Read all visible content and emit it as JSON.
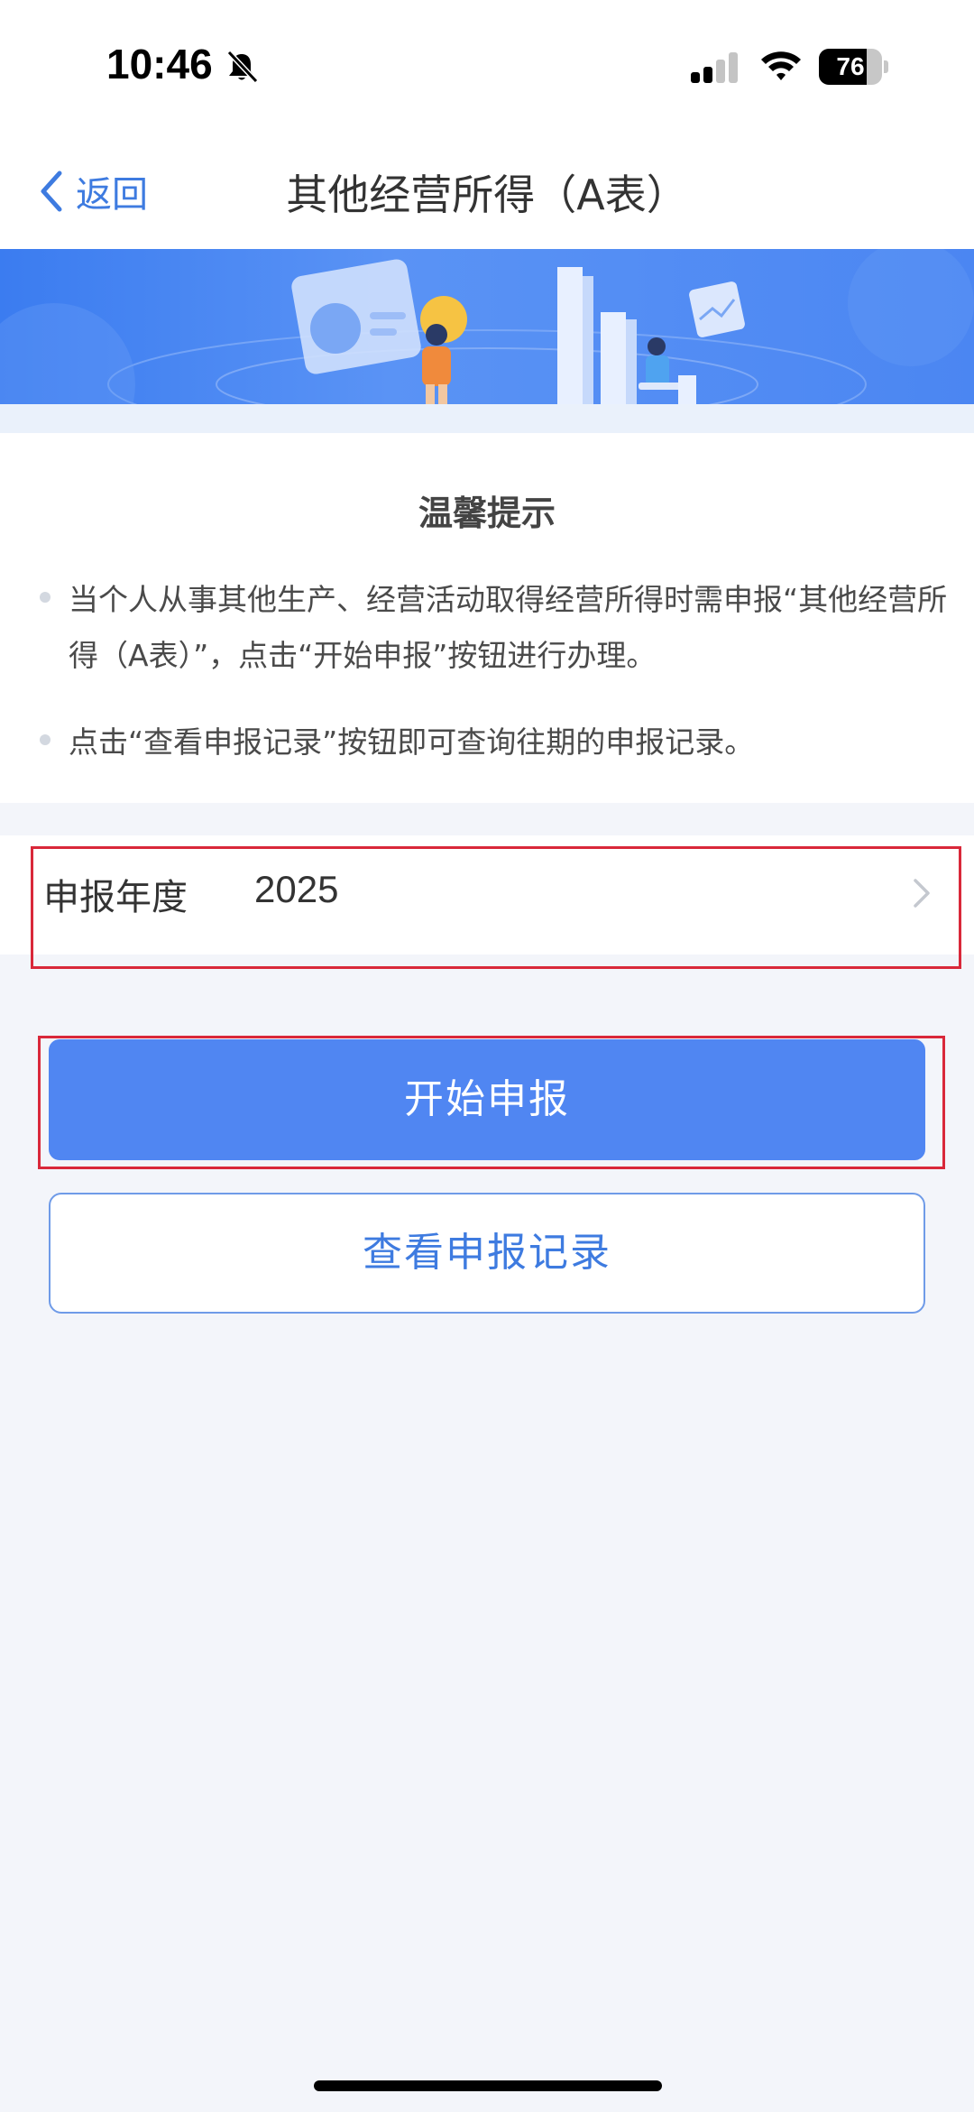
{
  "status_bar": {
    "time": "10:46",
    "battery_level": "76",
    "battery_fraction": 0.76,
    "icons": [
      "bell-slash-icon",
      "cellular-signal-icon",
      "wifi-icon",
      "battery-icon"
    ]
  },
  "nav": {
    "back_label": "返回",
    "title": "其他经营所得（A表）"
  },
  "tips": {
    "title": "温馨提示",
    "items": [
      "当个人从事其他生产、经营活动取得经营所得时需申报“其他经营所得（A表）”，点击“开始申报”按钮进行办理。",
      "点击“查看申报记录”按钮即可查询往期的申报记录。"
    ]
  },
  "year_selector": {
    "label": "申报年度",
    "value": "2025"
  },
  "actions": {
    "start_label": "开始申报",
    "records_label": "查看申报记录"
  },
  "colors": {
    "accent": "#5086f2",
    "link": "#3e7be0",
    "highlight": "#d9283a",
    "background": "#f3f5fa"
  }
}
